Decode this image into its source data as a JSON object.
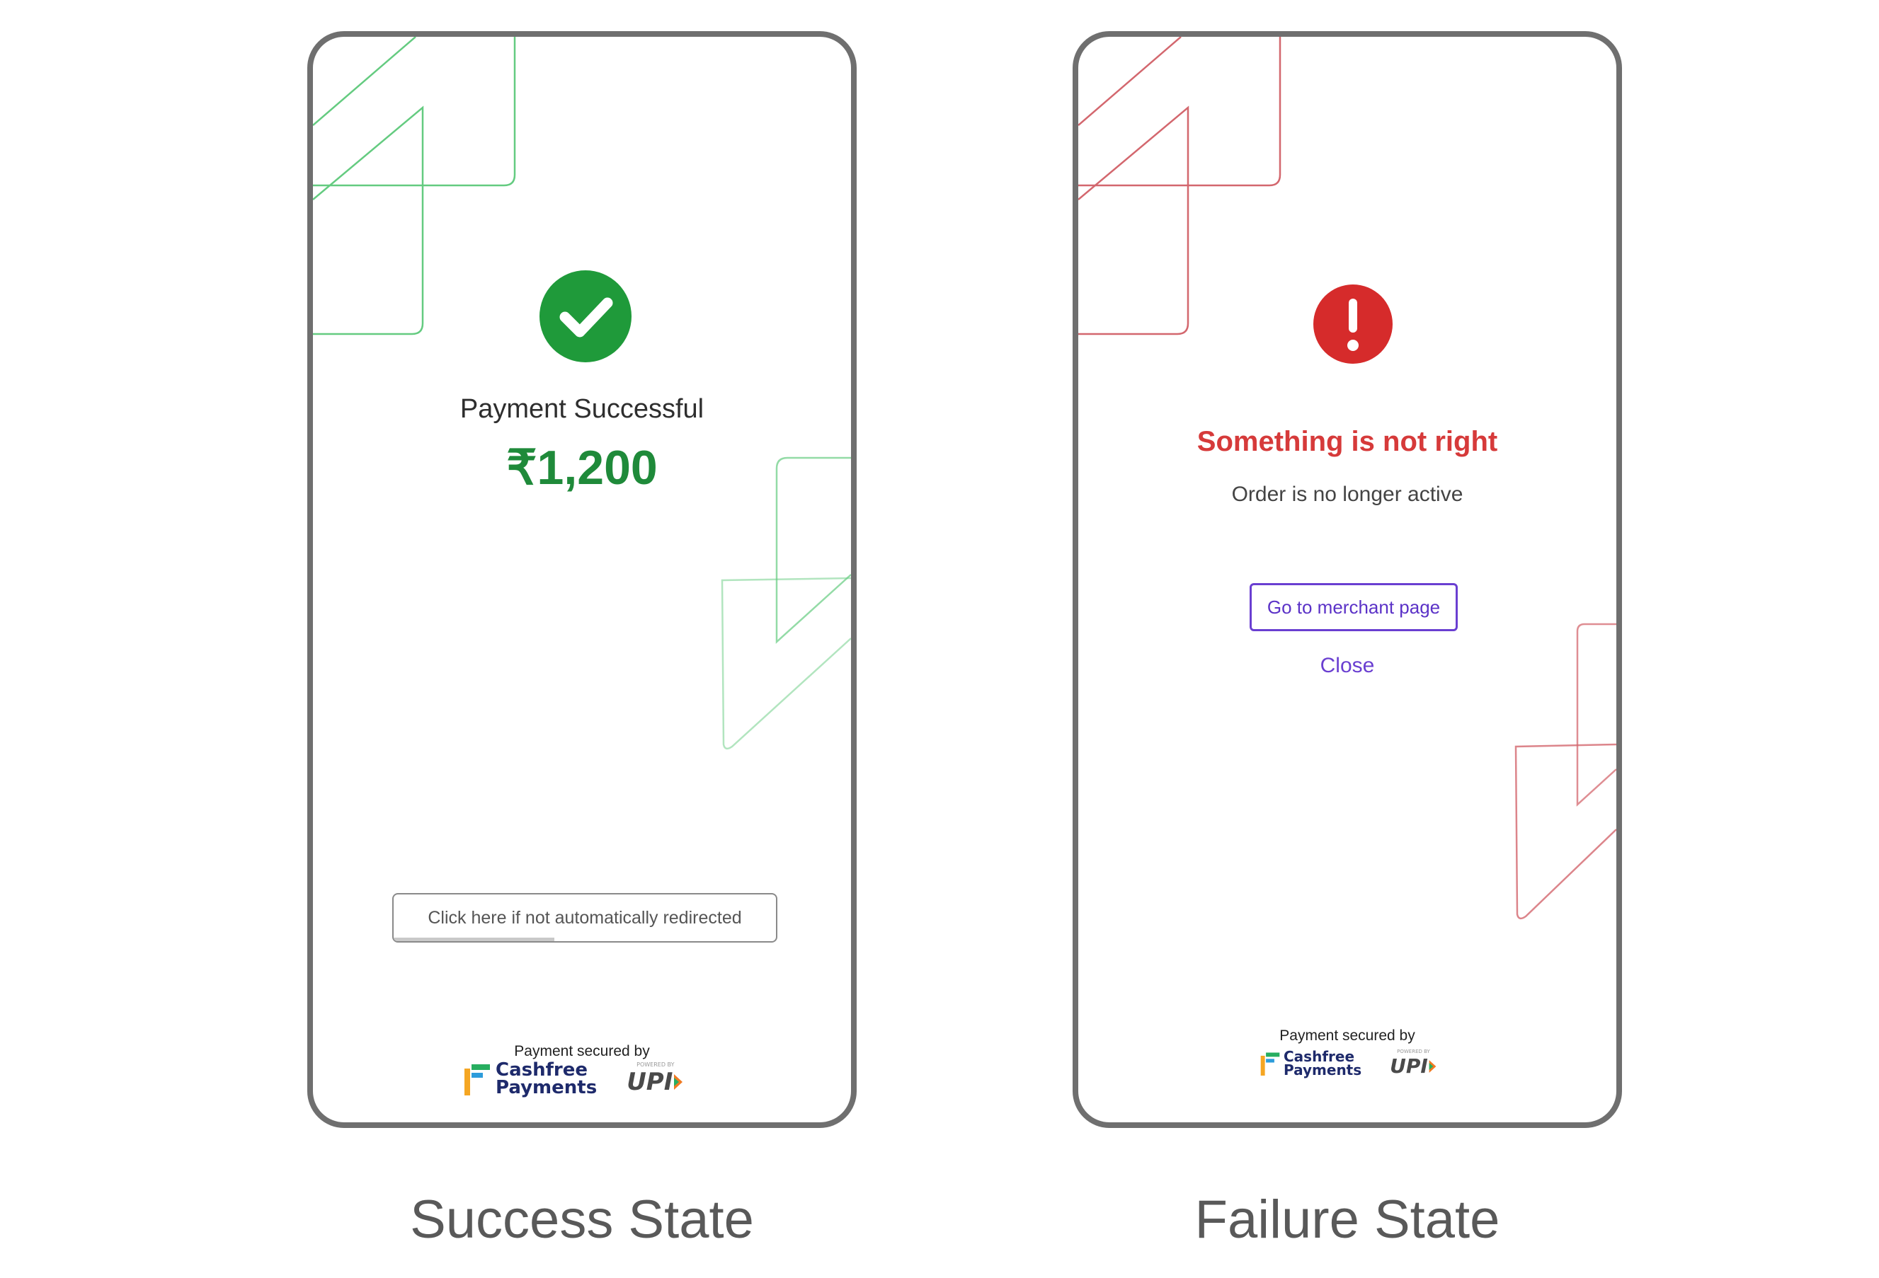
{
  "success": {
    "status_title": "Payment Successful",
    "amount": "₹1,200",
    "redirect_button": "Click here if not automatically redirected",
    "redirect_progress": 0.42,
    "state_label": "Success State",
    "accent": "#1f8a3a"
  },
  "failure": {
    "error_title": "Something is not right",
    "error_subtitle": "Order is no longer active",
    "merchant_button": "Go to merchant page",
    "close_link": "Close",
    "state_label": "Failure State",
    "accent": "#d63a3a",
    "link_color": "#6a3fd1"
  },
  "footer": {
    "secured_by": "Payment secured by",
    "cashfree_line1": "Cashfree",
    "cashfree_line2": "Payments",
    "powered_by": "POWERED BY",
    "upi": "UPI"
  },
  "icons": {
    "success": "check-circle-icon",
    "failure": "exclamation-circle-icon"
  }
}
